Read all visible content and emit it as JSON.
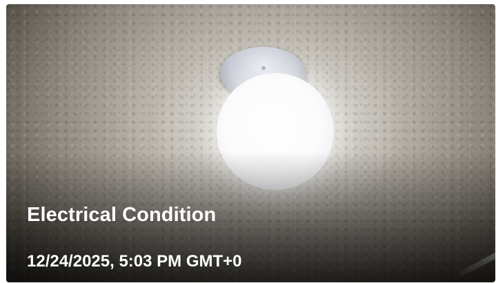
{
  "card": {
    "title": "Electrical Condition",
    "timestamp": "12/24/2025, 5:03 PM GMT+0",
    "image_subject": "ceiling-light-fixture"
  },
  "colors": {
    "text": "#ffffff",
    "overlay": "#000000",
    "background": "#ffffff"
  }
}
